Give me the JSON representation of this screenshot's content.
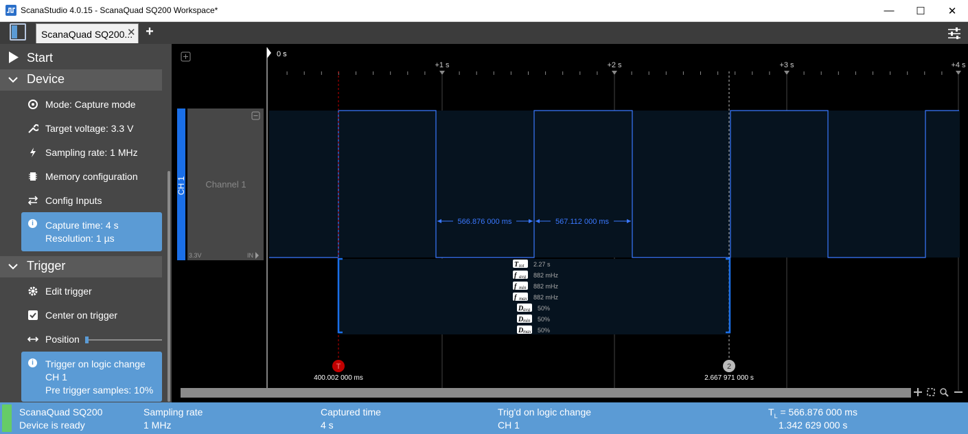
{
  "window": {
    "title": "ScanaStudio 4.0.15 - ScanaQuad SQ200 Workspace*",
    "minimize": "—",
    "maximize": "☐",
    "close": "✕"
  },
  "tabs": [
    {
      "label": "ScanaQuad SQ200...",
      "close": "✕"
    }
  ],
  "tab_add": "+",
  "sidebar": {
    "start_label": "Start",
    "device": {
      "title": "Device",
      "items": [
        {
          "icon": "gauge-icon",
          "label": "Mode: Capture mode"
        },
        {
          "icon": "wrench-icon",
          "label": "Target voltage: 3.3 V"
        },
        {
          "icon": "lightning-icon",
          "label": "Sampling rate: 1 MHz"
        },
        {
          "icon": "chip-icon",
          "label": "Memory configuration"
        },
        {
          "icon": "arrows-icon",
          "label": "Config Inputs"
        }
      ],
      "info": {
        "line1": "Capture time: 4 s",
        "line2": "Resolution: 1 µs"
      }
    },
    "trigger": {
      "title": "Trigger",
      "items": [
        {
          "icon": "gear-icon",
          "label": "Edit trigger"
        },
        {
          "icon": "checkbox-icon",
          "label": "Center on trigger"
        },
        {
          "icon": "double-arrow-icon",
          "label": "Position"
        }
      ],
      "position_slider": 0.0,
      "info": {
        "line1": "Trigger on logic change",
        "line2": "CH 1",
        "line3": "Pre trigger samples: 10%"
      }
    }
  },
  "timeline": {
    "origin_label": "0 s",
    "ticks": [
      "+1 s",
      "+2 s",
      "+3 s",
      "+4 s"
    ]
  },
  "channel": {
    "tag": "CH 1",
    "name": "Channel 1",
    "voltage": "3.3V",
    "input": "IN"
  },
  "measurements": {
    "period1": "566.876 000 ms",
    "period2": "567.112 000 ms"
  },
  "stats": [
    {
      "key": "T",
      "sub": "tot",
      "value": "2.27 s"
    },
    {
      "key": "f",
      "sub": "avg",
      "value": "882 mHz"
    },
    {
      "key": "f",
      "sub": "min",
      "value": "882 mHz"
    },
    {
      "key": "f",
      "sub": "max",
      "value": "882 mHz"
    },
    {
      "key": "D",
      "sub": "avg",
      "value": "50%"
    },
    {
      "key": "D",
      "sub": "min",
      "value": "50%"
    },
    {
      "key": "D",
      "sub": "max",
      "value": "50%"
    }
  ],
  "markers": {
    "trigger": {
      "symbol": "T",
      "label": "400.002 000 ms"
    },
    "cursor2": {
      "symbol": "2",
      "label": "2.667 971 000 s"
    }
  },
  "status": {
    "device_name": "ScanaQuad SQ200",
    "device_state": "Device is ready",
    "rate_label": "Sampling rate",
    "rate_value": "1 MHz",
    "captured_label": "Captured time",
    "captured_value": "4 s",
    "trig_label": "Trig'd on logic change",
    "trig_value": "CH 1",
    "tl_prefix": "T",
    "tl_sub": "L",
    "tl_value": " = 566.876 000 ms",
    "tl_value2": "1.342 629 000 s"
  },
  "colors": {
    "accent": "#5b9bd5",
    "signal": "#3a78ff",
    "trigger_marker": "#c00000",
    "status_ok": "#66cc66"
  }
}
